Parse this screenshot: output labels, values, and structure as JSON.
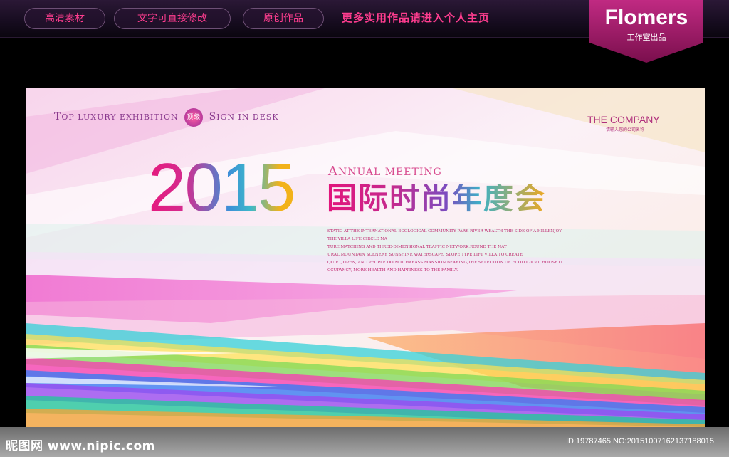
{
  "topbar": {
    "buttons": [
      "高清素材",
      "文字可直接修改",
      "原创作品"
    ],
    "promo": "更多实用作品请进入个人主页"
  },
  "brand": {
    "name": "Flomers",
    "subtitle": "工作室出品",
    "color": "#a3166a"
  },
  "poster": {
    "tagline": {
      "top_cap": "T",
      "top_rest": "OP",
      "luxury": "LUXURY",
      "exhibition": "EXHIBITION",
      "badge": "顶级",
      "sign_cap": "S",
      "sign_rest": "IGN",
      "in_desk": "IN DESK"
    },
    "company": "THE COMPANY",
    "company_sub": "请输入您的公司名称",
    "year": "2015",
    "annual_cap": "A",
    "annual_rest": "NNUAL MEETING",
    "title_cn": "国际时尚年度会",
    "description": [
      "STATIC AT THE INTERNATIONAL ECOLOGICAL COMMUNITY PARK RIVER WEALTH THE SIDE OF A HILLENJOY",
      "THE VILLA LIFE CIRCLE MA",
      "TURE MATCHING AND THREE-DIMENSIONAL TRAFFIC NETWORK,ROUND THE NAT",
      "URAL MOUNTAIN SCENERY, SUNSHINE WATERSCAPE, SLOPE TYPE LIFT VILLA,TO CREATE",
      "QUIET, OPEN, AND PEOPLE DO NOT HARASS MANSION BEARING,THE SELECTION OF ECOLOGICAL HOUSE O",
      "CCUPANCY, MORE HEALTH AND HAPPINESS TO THE FAMILY."
    ]
  },
  "footer": {
    "site": "昵图网 www.nipic.com",
    "id_line": "ID:19787465 NO:20151007162137188015"
  },
  "colors": {
    "accent_pink": "#ff3d8f",
    "magenta": "#e6197d",
    "cyan": "#3cb9c9",
    "gold": "#f2b21a"
  }
}
